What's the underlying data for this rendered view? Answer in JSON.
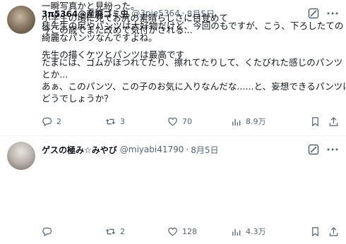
{
  "tweets": [
    {
      "name": "3π5364@産廃ゴミ虫",
      "handle": "@3pie5364",
      "dot": "·",
      "date": "8月5日",
      "lines": [
        "桂先生の尻やパンツは大好物だけど、今回のもですが、こう、下ろしたての",
        "綺麗なパンツなんですよね。",
        "",
        "たまには、ゴムがほつれてたり、擦れてたりして、くたびれた感じのパンツ",
        "とか...",
        "あぁ、このパンツ、この子のお気に入りなんだな......と、妄想できるパンツは",
        "どうでしょうか？"
      ],
      "replies": "2",
      "reposts": "3",
      "likes": "70",
      "views": "8.9万"
    },
    {
      "name": "ゲスの極み☆みやび",
      "handle": "@miyabi41790",
      "dot": "·",
      "date": "8月5日",
      "lines": [
        "一瞬写真かと見紛った。",
        "小学生の頃に見てお尻の素晴らしさに目覚めて",
        "今この歳でまた改めて気付かされる...",
        "",
        "先生の描くケツとパンツは最高です"
      ],
      "replies": "",
      "reposts": "2",
      "likes": "128",
      "views": "4.3万"
    }
  ],
  "icons": {
    "grok": "grok-icon",
    "more": "more-icon",
    "reply": "reply-icon",
    "repost": "repost-icon",
    "like": "like-icon",
    "views": "views-icon",
    "bookmark": "bookmark-icon",
    "share": "share-icon"
  },
  "colors": {
    "text": "#0f1419",
    "secondary": "#536471",
    "divider": "#eff3f4"
  }
}
